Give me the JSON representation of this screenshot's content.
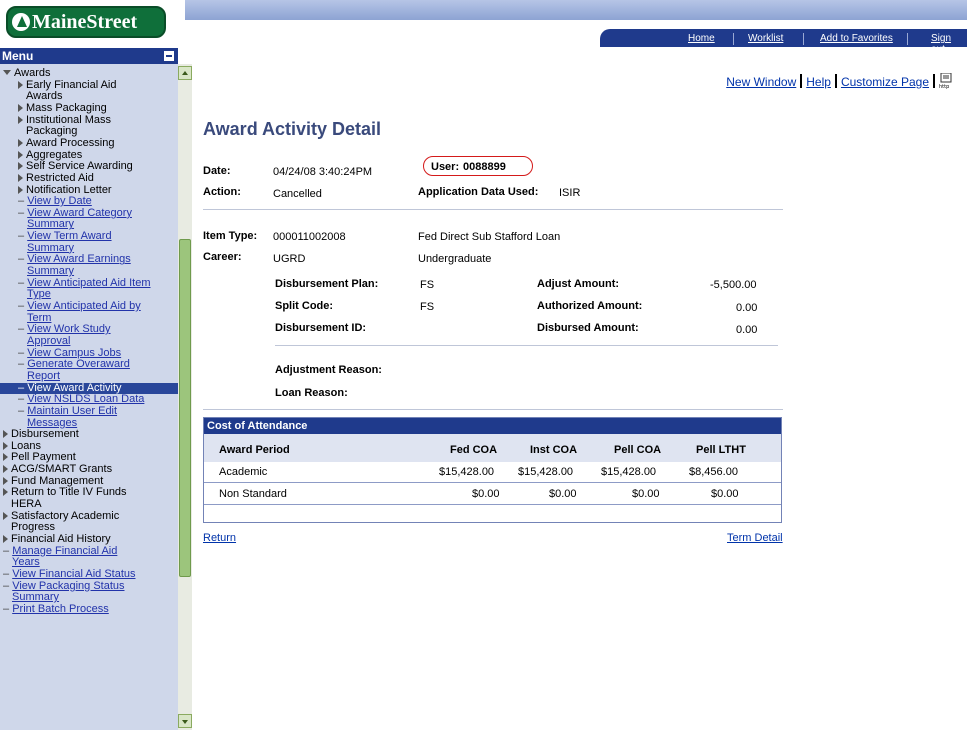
{
  "header": {
    "logo_text": "MaineStreet",
    "nav": [
      "Home",
      "Worklist",
      "Add to Favorites",
      "Sign out"
    ]
  },
  "menu": {
    "title": "Menu",
    "items": [
      {
        "label": "Awards",
        "type": "expanded",
        "indent": 0
      },
      {
        "label": "Early Financial Aid",
        "type": "folder",
        "indent": 1
      },
      {
        "label": "Awards",
        "type": "cont",
        "indent": 1
      },
      {
        "label": "Mass Packaging",
        "type": "folder",
        "indent": 1
      },
      {
        "label": "Institutional Mass",
        "type": "folder",
        "indent": 1
      },
      {
        "label": "Packaging",
        "type": "cont",
        "indent": 1
      },
      {
        "label": "Award Processing",
        "type": "folder",
        "indent": 1
      },
      {
        "label": "Aggregates",
        "type": "folder",
        "indent": 1
      },
      {
        "label": "Self Service Awarding",
        "type": "folder",
        "indent": 1
      },
      {
        "label": "Restricted Aid",
        "type": "folder",
        "indent": 1
      },
      {
        "label": "Notification Letter",
        "type": "folder",
        "indent": 1
      },
      {
        "label": "View by Date",
        "type": "link",
        "indent": 1
      },
      {
        "label": "View Award Category",
        "type": "link",
        "indent": 1
      },
      {
        "label": "Summary",
        "type": "linkcont",
        "indent": 1
      },
      {
        "label": "View Term Award",
        "type": "link",
        "indent": 1
      },
      {
        "label": "Summary",
        "type": "linkcont",
        "indent": 1
      },
      {
        "label": "View Award Earnings",
        "type": "link",
        "indent": 1
      },
      {
        "label": "Summary",
        "type": "linkcont",
        "indent": 1
      },
      {
        "label": "View Anticipated Aid Item",
        "type": "link",
        "indent": 1
      },
      {
        "label": "Type",
        "type": "linkcont",
        "indent": 1
      },
      {
        "label": "View Anticipated Aid by",
        "type": "link",
        "indent": 1
      },
      {
        "label": "Term",
        "type": "linkcont",
        "indent": 1
      },
      {
        "label": "View Work Study",
        "type": "link",
        "indent": 1
      },
      {
        "label": "Approval",
        "type": "linkcont",
        "indent": 1
      },
      {
        "label": "View Campus Jobs",
        "type": "link",
        "indent": 1
      },
      {
        "label": "Generate Overaward",
        "type": "link",
        "indent": 1
      },
      {
        "label": "Report",
        "type": "linkcont",
        "indent": 1
      },
      {
        "label": "View Award Activity",
        "type": "selected",
        "indent": 1
      },
      {
        "label": "View NSLDS Loan Data",
        "type": "link",
        "indent": 1
      },
      {
        "label": "Maintain User Edit",
        "type": "link",
        "indent": 1
      },
      {
        "label": "Messages",
        "type": "linkcont",
        "indent": 1
      },
      {
        "label": "Disbursement",
        "type": "folder",
        "indent": 0
      },
      {
        "label": "Loans",
        "type": "folder",
        "indent": 0
      },
      {
        "label": "Pell Payment",
        "type": "folder",
        "indent": 0
      },
      {
        "label": "ACG/SMART Grants",
        "type": "folder",
        "indent": 0
      },
      {
        "label": "Fund Management",
        "type": "folder",
        "indent": 0
      },
      {
        "label": "Return to Title IV Funds",
        "type": "folder",
        "indent": 0
      },
      {
        "label": "HERA",
        "type": "cont",
        "indent": 0
      },
      {
        "label": "Satisfactory Academic",
        "type": "folder",
        "indent": 0
      },
      {
        "label": "Progress",
        "type": "cont",
        "indent": 0
      },
      {
        "label": "Financial Aid History",
        "type": "folder",
        "indent": 0
      },
      {
        "label": "Manage Financial Aid",
        "type": "link",
        "indent": 0
      },
      {
        "label": "Years",
        "type": "linkcont",
        "indent": 0
      },
      {
        "label": "View Financial Aid Status",
        "type": "link",
        "indent": 0
      },
      {
        "label": "View Packaging Status",
        "type": "link",
        "indent": 0
      },
      {
        "label": "Summary",
        "type": "linkcont",
        "indent": 0
      },
      {
        "label": "Print Batch Process",
        "type": "link",
        "indent": 0
      }
    ]
  },
  "toplinks": {
    "new_window": "New Window",
    "help": "Help",
    "customize": "Customize Page",
    "http_icon_text": "http"
  },
  "page": {
    "title": "Award Activity Detail",
    "date_label": "Date:",
    "date_value": "04/24/08  3:40:24PM",
    "user_label": "User:",
    "user_value": "0088899",
    "action_label": "Action:",
    "action_value": "Cancelled",
    "app_data_label": "Application Data Used:",
    "app_data_value": "ISIR",
    "item_type_label": "Item Type:",
    "item_type_value": "000011002008",
    "item_type_desc": "Fed Direct Sub Stafford Loan",
    "career_label": "Career:",
    "career_value": "UGRD",
    "career_desc": "Undergraduate",
    "disb_plan_label": "Disbursement Plan:",
    "disb_plan_value": "FS",
    "split_code_label": "Split Code:",
    "split_code_value": "FS",
    "disb_id_label": "Disbursement ID:",
    "adjust_amount_label": "Adjust Amount:",
    "adjust_amount_value": "-5,500.00",
    "authorized_amount_label": "Authorized Amount:",
    "authorized_amount_value": "0.00",
    "disbursed_amount_label": "Disbursed Amount:",
    "disbursed_amount_value": "0.00",
    "adj_reason_label": "Adjustment Reason:",
    "loan_reason_label": "Loan Reason:"
  },
  "coa": {
    "title": "Cost of Attendance",
    "columns": [
      "Award Period",
      "Fed COA",
      "Inst COA",
      "Pell COA",
      "Pell LTHT"
    ],
    "rows": [
      [
        "Academic",
        "$15,428.00",
        "$15,428.00",
        "$15,428.00",
        "$8,456.00"
      ],
      [
        "Non Standard",
        "$0.00",
        "$0.00",
        "$0.00",
        "$0.00"
      ]
    ]
  },
  "footer": {
    "return": "Return",
    "term_detail": "Term Detail"
  }
}
